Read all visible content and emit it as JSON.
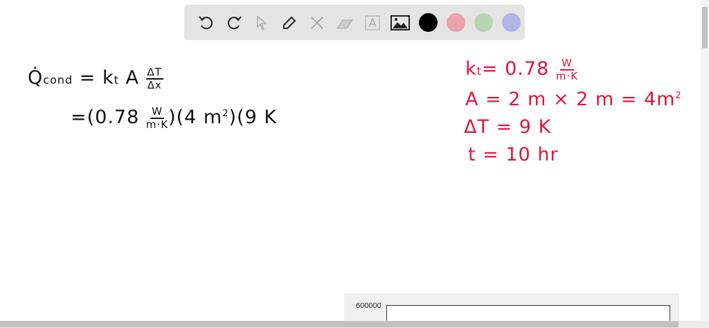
{
  "toolbar": {
    "tools": [
      "undo-icon",
      "redo-icon",
      "select-icon",
      "pen-icon",
      "tools-icon",
      "eraser-icon",
      "text-icon",
      "image-icon"
    ],
    "colors": {
      "black": "#000000",
      "red": "#eba3ab",
      "green": "#b5d6b1",
      "blue": "#b3b5e8"
    }
  },
  "work": {
    "line1_lhs": "Q̇",
    "line1_sub": "cond",
    "line1_eq": "= k",
    "line1_ksub": "t",
    "line1_A": "A",
    "line1_num": "ΔT",
    "line1_den": "Δx",
    "line2_a": "=(0.78",
    "line2_num": "W",
    "line2_den": "m·K",
    "line2_b": ")(4 m",
    "line2_sup": "2",
    "line2_c": ")(9 K"
  },
  "given": {
    "k_label": "k",
    "k_sub": "t",
    "k_val": "= 0.78",
    "k_num": "W",
    "k_den": "m·K",
    "A": "A = 2 m × 2 m = 4m",
    "A_sup": "2",
    "dT": "ΔT = 9 K",
    "t": "t = 10 hr"
  },
  "plot": {
    "y_label": "600000"
  }
}
